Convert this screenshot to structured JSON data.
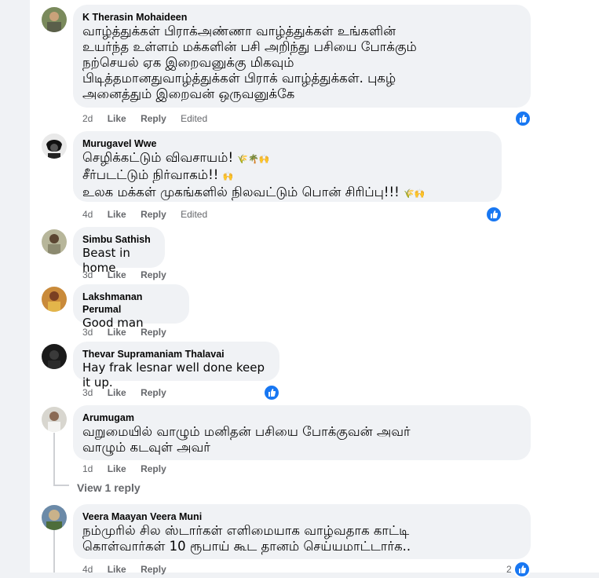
{
  "comments": [
    {
      "author": "K Therasin Mohaideen",
      "text": "வாழ்த்துக்கள் பிராக்அண்ணா வாழ்த்துக்கள் உங்களின்\nஉயர்ந்த உள்ளம் மக்களின் பசி அறிந்து பசியை போக்கும்\nநற்செயல் ஏக இறைவனுக்கு மிகவும்\nபிடித்தமானதுவாழ்த்துக்கள் பிராக் வாழ்த்துக்கள். புகழ்\nஅனைத்தும் இறைவன் ஒருவனுக்கே",
      "time": "2d",
      "like": "Like",
      "reply": "Reply",
      "edited": "Edited"
    },
    {
      "author": "Murugavel Wwe",
      "line1": "செழிக்கட்டும் விவசாயம்!",
      "line1_emoji": "🌾🌴🙌",
      "line2": "சீர்படட்டும் நிர்வாகம்!!",
      "line2_emoji": "🙌",
      "line3": "உலக மக்கள் முகங்களில் நிலவட்டும் பொன் சிரிப்பு!!!",
      "line3_emoji": "🌾🙌",
      "time": "4d",
      "like": "Like",
      "reply": "Reply",
      "edited": "Edited"
    },
    {
      "author": "Simbu Sathish",
      "text": "Beast in home",
      "time": "3d",
      "like": "Like",
      "reply": "Reply"
    },
    {
      "author": "Lakshmanan Perumal",
      "text": "Good man",
      "time": "3d",
      "like": "Like",
      "reply": "Reply"
    },
    {
      "author": "Thevar Supramaniam Thalavai",
      "text": "Hay frak lesnar well done keep it up.",
      "time": "3d",
      "like": "Like",
      "reply": "Reply"
    },
    {
      "author": "Arumugam",
      "text": "வறுமையில் வாழும் மனிதன் பசியை போக்குவன் அவர்\nவாழும் கடவுள் அவர்",
      "time": "1d",
      "like": "Like",
      "reply": "Reply",
      "view_replies": "View 1 reply"
    },
    {
      "author": "Veera Maayan Veera Muni",
      "text": "நம்முரில் சில ஸ்டார்கள் எளிமையாக வாழ்வதாக காட்டி\nகொள்வார்கள் 10 ரூபாய் கூட தானம் செய்யமாட்டார்க..",
      "time": "4d",
      "like": "Like",
      "reply": "Reply",
      "reaction_count": "2"
    }
  ],
  "colors": {
    "like_blue": "#1877f2",
    "bubble_bg": "#f0f2f5",
    "meta_gray": "#65676b"
  }
}
